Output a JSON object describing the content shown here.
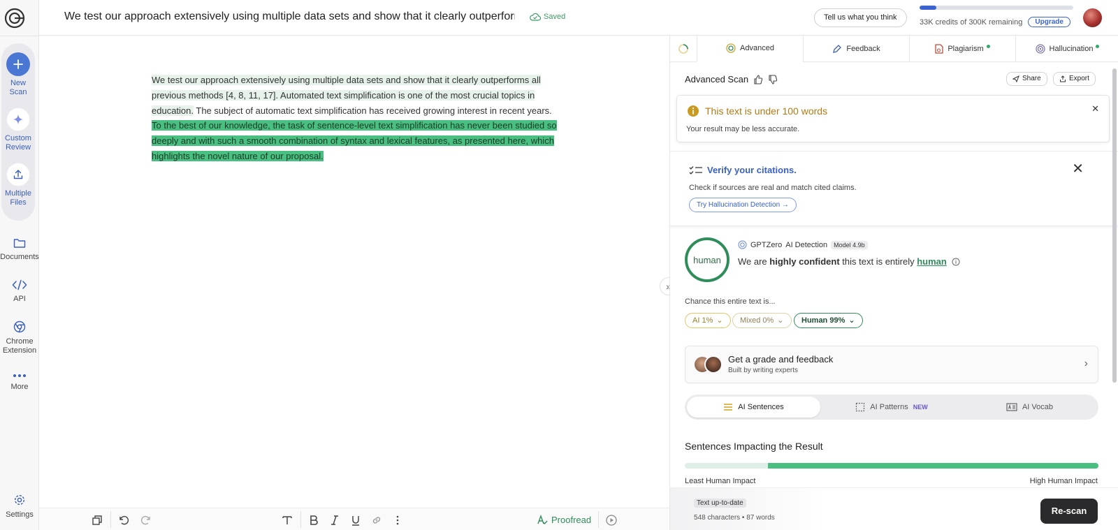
{
  "sidebar": {
    "actions": [
      {
        "label_1": "New",
        "label_2": "Scan"
      },
      {
        "label_1": "Custom",
        "label_2": "Review"
      },
      {
        "label_1": "Multiple",
        "label_2": "Files"
      }
    ],
    "nav": [
      {
        "label_1": "Documents",
        "label_2": ""
      },
      {
        "label_1": "API",
        "label_2": ""
      },
      {
        "label_1": "Chrome",
        "label_2": "Extension"
      },
      {
        "label_1": "More",
        "label_2": ""
      }
    ],
    "settings_label": "Settings"
  },
  "header": {
    "doc_title": "We test our approach extensively using multiple data sets and show that it clearly outperforms all p",
    "saved_label": "Saved",
    "feedback_button": "Tell us what you think",
    "credits_text": "33K credits of 300K remaining",
    "credits_fraction": 0.11,
    "upgrade_button": "Upgrade"
  },
  "editor": {
    "seg1": "We test our approach extensively using multiple data sets and show that it clearly outperforms all previous methods [4, 8, 11, 17].",
    "seg2": " Automated text simplification is one of the most crucial topics in education.",
    "seg3": " The subject of automatic text simplification has received growing interest in recent years. ",
    "seg4": "To the best of our knowledge, the task of sentence-level text simplification has never been studied so deeply and with such a smooth combination of syntax and lexical features, as presented here, which highlights the novel nature of our proposal."
  },
  "toolbar": {
    "proofread_label": "Proofread"
  },
  "panel": {
    "tabs": [
      "Advanced",
      "Feedback",
      "Plagiarism",
      "Hallucination"
    ],
    "advanced_title": "Advanced Scan",
    "share_label": "Share",
    "export_label": "Export",
    "warning_title": "This text is under 100 words",
    "warning_sub": "Your result may be less accurate.",
    "verify_title": "Verify your citations.",
    "verify_sub": "Check if sources are real and match cited claims.",
    "verify_button": "Try Hallucination Detection →",
    "result_ring": "human",
    "detector_brand": "GPTZero",
    "detector_name": "AI Detection",
    "model_badge": "Model 4.9b",
    "confidence": {
      "pre": "We are ",
      "strong": "highly confident",
      "mid": " this text is entirely ",
      "word": "human"
    },
    "chance_label": "Chance this entire text is...",
    "pills": {
      "ai": "AI 1%",
      "mixed": "Mixed 0%",
      "human": "Human 99%"
    },
    "grade_title": "Get a grade and feedback",
    "grade_sub": "Built by writing experts",
    "segments": {
      "sentences": "AI Sentences",
      "patterns": "AI Patterns",
      "patterns_badge": "NEW",
      "vocab": "AI Vocab"
    },
    "impact_title": "Sentences Impacting the Result",
    "impact_left": "Least Human Impact",
    "impact_right": "High Human Impact",
    "status_badge": "Text up-to-date",
    "counts": "548 characters • 87 words",
    "rescan_button": "Re-scan"
  }
}
